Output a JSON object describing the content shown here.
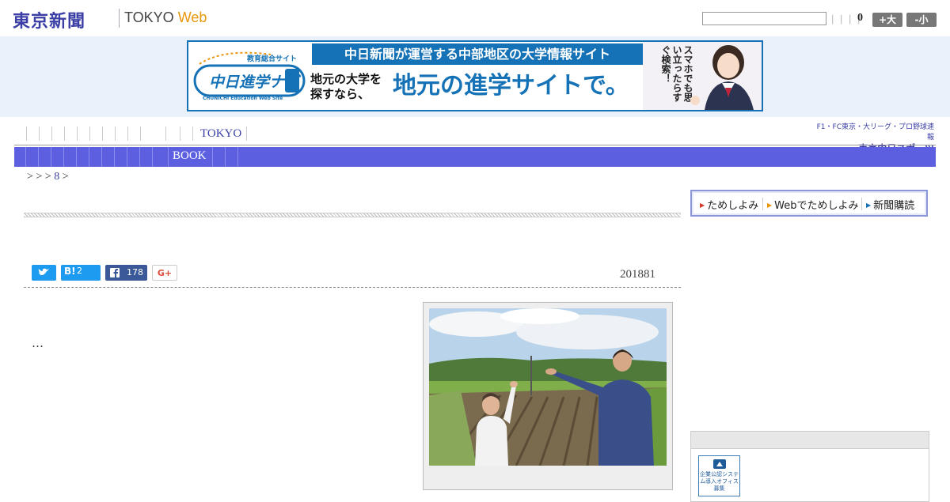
{
  "header": {
    "logo": "東京新聞",
    "logo_sub": "TOKYO",
    "logo_sub_web": "Web",
    "search_placeholder": "",
    "separators": "| | | |",
    "count": "0",
    "font_larger": "+大",
    "font_smaller": "-小"
  },
  "ad": {
    "logo_top": "教育総合サイト",
    "logo_main": "中日進学ナビ",
    "logo_sub": "CHUNICHI Education Web Site",
    "headline": "中日新聞が運営する中部地区の大学情報サイト",
    "left_text": "地元の大学を探すなら、",
    "big_text": "地元の進学サイトで。",
    "vertical_text": "スマホでも思い立ったらすぐ検索！"
  },
  "nav": {
    "tokyo": "TOKYO",
    "book": "BOOK",
    "chunichi_top": "F1・FC東京・大リーグ・プロ野球速報",
    "chunichi_bottom": "東京中日スポーツ"
  },
  "breadcrumb": {
    "prefix": "> > >",
    "link": "8",
    "suffix": ">"
  },
  "share": {
    "hatena_label": "B!",
    "hatena_count": "2",
    "facebook_count": "178",
    "gplus_label": "G+"
  },
  "article": {
    "date": "201881",
    "body": "…"
  },
  "sidebar": {
    "subscribe": [
      "ためしよみ",
      "Webでためしよみ",
      "新聞購読"
    ],
    "badge_text": "企業公認システム導入オフィス募集"
  },
  "colors": {
    "brand": "#3b3fa5",
    "nav_bar": "#5b5fe0",
    "ad_blue": "#1572b6",
    "accent_orange": "#e8960c"
  }
}
